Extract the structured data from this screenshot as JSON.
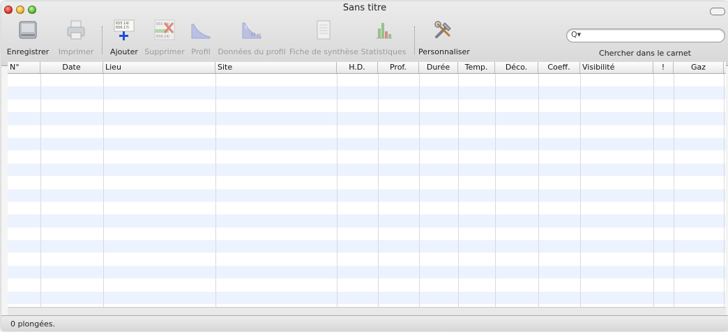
{
  "window": {
    "title": "Sans titre"
  },
  "toolbar": {
    "save": "Enregistrer",
    "print": "Imprimer",
    "add": "Ajouter",
    "delete": "Supprimer",
    "profile": "Profil",
    "profile_data": "Données du profil",
    "summary_sheet": "Fiche de synthèse",
    "statistics": "Statistiques",
    "customize": "Personnaliser"
  },
  "search": {
    "placeholder": "",
    "value": "",
    "label": "Chercher dans le carnet"
  },
  "table": {
    "columns": [
      "N°",
      "Date",
      "Lieu",
      "Site",
      "H.D.",
      "Prof.",
      "Durée",
      "Temp.",
      "Déco.",
      "Coeff.",
      "Visibilité",
      "!",
      "Gaz"
    ],
    "rows": []
  },
  "status": {
    "text": "0 plongées."
  },
  "colors": {
    "row_stripe": "#edf3fe",
    "add_plus": "#1f4fd6",
    "delete_x": "#d63b2b"
  },
  "icons": [
    "hard-drive-icon",
    "printer-icon",
    "add-dive-icon",
    "delete-dive-icon",
    "profile-chart-icon",
    "profile-data-icon",
    "summary-sheet-icon",
    "statistics-icon",
    "tools-icon",
    "search-icon"
  ]
}
